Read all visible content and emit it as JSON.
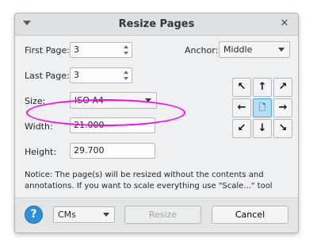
{
  "window": {
    "title": "Resize Pages",
    "close_glyph": "✕"
  },
  "form": {
    "first_page_label": "First Page:",
    "first_page_value": "3",
    "last_page_label": "Last Page:",
    "last_page_value": "3",
    "size_label": "Size:",
    "size_value": "ISO A4",
    "width_label": "Width:",
    "width_value": "21.000",
    "height_label": "Height:",
    "height_value": "29.700",
    "anchor_label": "Anchor:",
    "anchor_value": "Middle"
  },
  "anchor_grid": [
    {
      "name": "anchor-top-left",
      "glyph": "↖",
      "selected": false
    },
    {
      "name": "anchor-top",
      "glyph": "↑",
      "selected": false
    },
    {
      "name": "anchor-top-right",
      "glyph": "↗",
      "selected": false
    },
    {
      "name": "anchor-left",
      "glyph": "←",
      "selected": false
    },
    {
      "name": "anchor-middle",
      "glyph": "🗋",
      "selected": true
    },
    {
      "name": "anchor-right",
      "glyph": "→",
      "selected": false
    },
    {
      "name": "anchor-bottom-left",
      "glyph": "↙",
      "selected": false
    },
    {
      "name": "anchor-bottom",
      "glyph": "↓",
      "selected": false
    },
    {
      "name": "anchor-bottom-right",
      "glyph": "↘",
      "selected": false
    }
  ],
  "notice": "Notice: The page(s) will be resized without the contents and annotations. If you want to scale everything use \"Scale...\" tool",
  "footer": {
    "help_glyph": "?",
    "units_value": "CMs",
    "resize_label": "Resize",
    "cancel_label": "Cancel"
  },
  "colors": {
    "highlight_ellipse": "#ff00ff",
    "selected_anchor": "#b8dcf5",
    "help_button": "#2f8fd8"
  },
  "icons": {
    "menu": "chevron-down-icon",
    "close": "close-icon",
    "help": "help-icon"
  }
}
